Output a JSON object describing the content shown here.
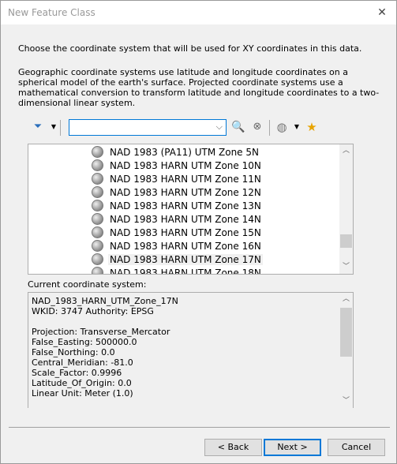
{
  "window": {
    "title": "New Feature Class"
  },
  "instructions": {
    "line1": "Choose the coordinate system that will be used for XY coordinates in this data.",
    "line2": "Geographic coordinate systems use latitude and longitude coordinates on a spherical model of the earth's surface. Projected coordinate systems use a mathematical conversion to transform latitude and longitude coordinates to a two-dimensional linear system."
  },
  "toolbar": {
    "search_value": "",
    "icons": [
      "filter-icon",
      "search-icon",
      "clear-search-icon",
      "globe-add-icon",
      "favorite-add-icon"
    ]
  },
  "list": {
    "items": [
      "NAD 1983 (PA11) UTM Zone 5N",
      "NAD 1983 HARN UTM Zone 10N",
      "NAD 1983 HARN UTM Zone 11N",
      "NAD 1983 HARN UTM Zone 12N",
      "NAD 1983 HARN UTM Zone 13N",
      "NAD 1983 HARN UTM Zone 14N",
      "NAD 1983 HARN UTM Zone 15N",
      "NAD 1983 HARN UTM Zone 16N",
      "NAD 1983 HARN UTM Zone 17N",
      "NAD 1983 HARN UTM Zone 18N"
    ],
    "selected": "NAD 1983 HARN UTM Zone 17N"
  },
  "current": {
    "label": "Current coordinate system:",
    "text": "NAD_1983_HARN_UTM_Zone_17N\nWKID: 3747 Authority: EPSG\n\nProjection: Transverse_Mercator\nFalse_Easting: 500000.0\nFalse_Northing: 0.0\nCentral_Meridian: -81.0\nScale_Factor: 0.9996\nLatitude_Of_Origin: 0.0\nLinear Unit: Meter (1.0)"
  },
  "buttons": {
    "back": "< Back",
    "next": "Next >",
    "cancel": "Cancel"
  }
}
